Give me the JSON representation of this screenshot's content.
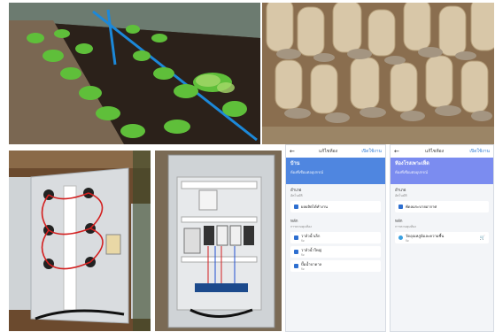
{
  "photos": {
    "lettuce": "lettuce-bed",
    "mushroom": "mushroom-bags",
    "cabinet_open": "control-cabinet-open-door",
    "cabinet_inside": "control-cabinet-inside"
  },
  "phone1": {
    "top_title": "แก้ไขห้อง",
    "top_action": "เปิดใช้งาน",
    "hero_title": "บ้าน",
    "hero_sub": "ห้องที่เชื่อมต่ออุปกรณ์",
    "section1_title": "อำเภอ",
    "section1_sub": "อัตโนมัติ",
    "row1": "ผลผลิตได้ทำงาน",
    "section2_title": "หลัก",
    "section2_sub": "การควบคุมห้อง",
    "row2": "วาล์วน้ำเล็ก",
    "row3": "วาล์วน้ำใหญ่",
    "row4": "ปั๊มน้ำบาดาล",
    "row_status": "ปิด"
  },
  "phone2": {
    "top_title": "แก้ไขห้อง",
    "top_action": "เปิดใช้งาน",
    "hero_title": "ห้องโรงเพาะเห็ด",
    "hero_sub": "ห้องที่เชื่อมต่ออุปกรณ์",
    "section1_title": "อำเภอ",
    "section1_sub": "อัตโนมัติ",
    "row1": "พัดลมระบายอากาศ",
    "section2_title": "หลัก",
    "section2_sub": "การควบคุมห้อง",
    "row2": "วัดอุณหภูมิและความชื้น",
    "row_status": "ปิด"
  },
  "colors": {
    "hero1": "#4f86e0",
    "hero2": "#7b8cf0",
    "accent": "#2e7bd6"
  }
}
